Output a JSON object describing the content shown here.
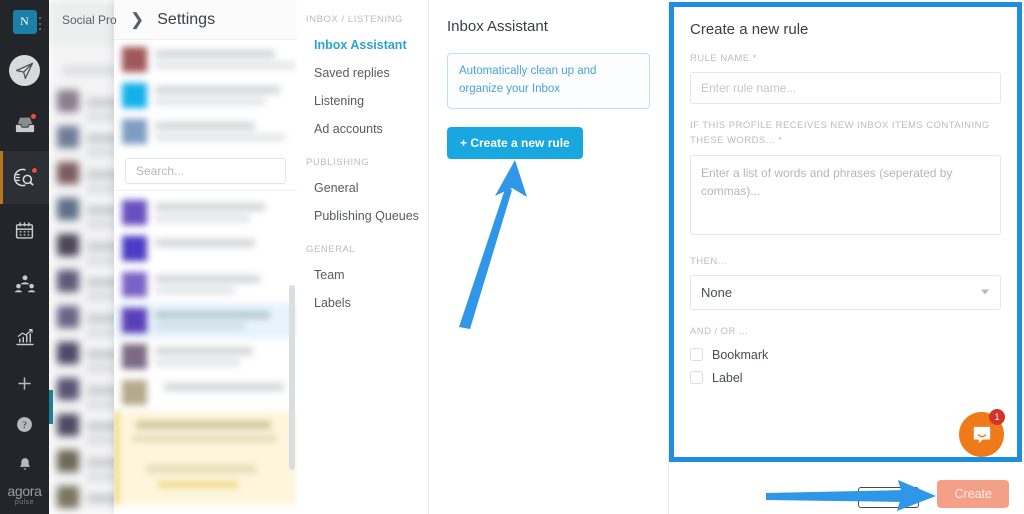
{
  "app": {
    "brand_name": "agora",
    "brand_sub": "pulse",
    "profile_initial": "N",
    "accent_blue": "#19a7df",
    "annotation_blue": "#1e8fe0",
    "active_nav_color": "#2ba5c9",
    "create_button_color": "#f4a088",
    "intercom_color": "#f07a1a",
    "badge_color": "#d0342a"
  },
  "rail": {
    "items": [
      {
        "name": "publish-icon",
        "label": "Publish"
      },
      {
        "name": "inbox-icon",
        "label": "Inbox",
        "badge": true
      },
      {
        "name": "listening-icon",
        "label": "Listening",
        "badge": true,
        "active": true
      },
      {
        "name": "calendar-icon",
        "label": "Calendar"
      },
      {
        "name": "team-icon",
        "label": "Team"
      },
      {
        "name": "reports-icon",
        "label": "Reports"
      }
    ],
    "bottom_items": [
      {
        "name": "add-icon",
        "label": "Add"
      },
      {
        "name": "help-icon",
        "label": "Help"
      },
      {
        "name": "notifications-icon",
        "label": "Notifications"
      }
    ]
  },
  "background": {
    "app_title": "Social Pro",
    "search_placeholder": "Search..."
  },
  "settings_flyout": {
    "back_icon": "chevron-right-icon",
    "title": "Settings",
    "search_placeholder": "Search..."
  },
  "settings_nav": {
    "groups": [
      {
        "label": "INBOX / LISTENING",
        "items": [
          {
            "label": "Inbox Assistant",
            "active": true
          },
          {
            "label": "Saved replies",
            "active": false
          },
          {
            "label": "Listening",
            "active": false
          },
          {
            "label": "Ad accounts",
            "active": false
          }
        ]
      },
      {
        "label": "PUBLISHING",
        "items": [
          {
            "label": "General",
            "active": false
          },
          {
            "label": "Publishing Queues",
            "active": false
          }
        ]
      },
      {
        "label": "GENERAL",
        "items": [
          {
            "label": "Team",
            "active": false
          },
          {
            "label": "Labels",
            "active": false
          }
        ]
      }
    ]
  },
  "inbox_assistant": {
    "title": "Inbox Assistant",
    "notice": "Automatically clean up and organize your Inbox",
    "create_rule_button": "+ Create a new rule"
  },
  "rule_form": {
    "title": "Create a new rule",
    "rule_name_label": "RULE NAME *",
    "rule_name_value": "",
    "rule_name_placeholder": "Enter rule name...",
    "words_label": "IF THIS PROFILE RECEIVES NEW INBOX ITEMS CONTAINING THESE WORDS... *",
    "words_value": "",
    "words_placeholder": "Enter a list of words and phrases (seperated by commas)...",
    "then_label": "THEN...",
    "then_selected": "None",
    "then_options": [
      "None"
    ],
    "and_or_label": "AND / OR ...",
    "checkboxes": [
      {
        "label": "Bookmark",
        "checked": false
      },
      {
        "label": "Label",
        "checked": false
      }
    ],
    "submit_label": "Create"
  },
  "intercom": {
    "icon": "chat-bubble-icon",
    "unread_count": "1"
  }
}
